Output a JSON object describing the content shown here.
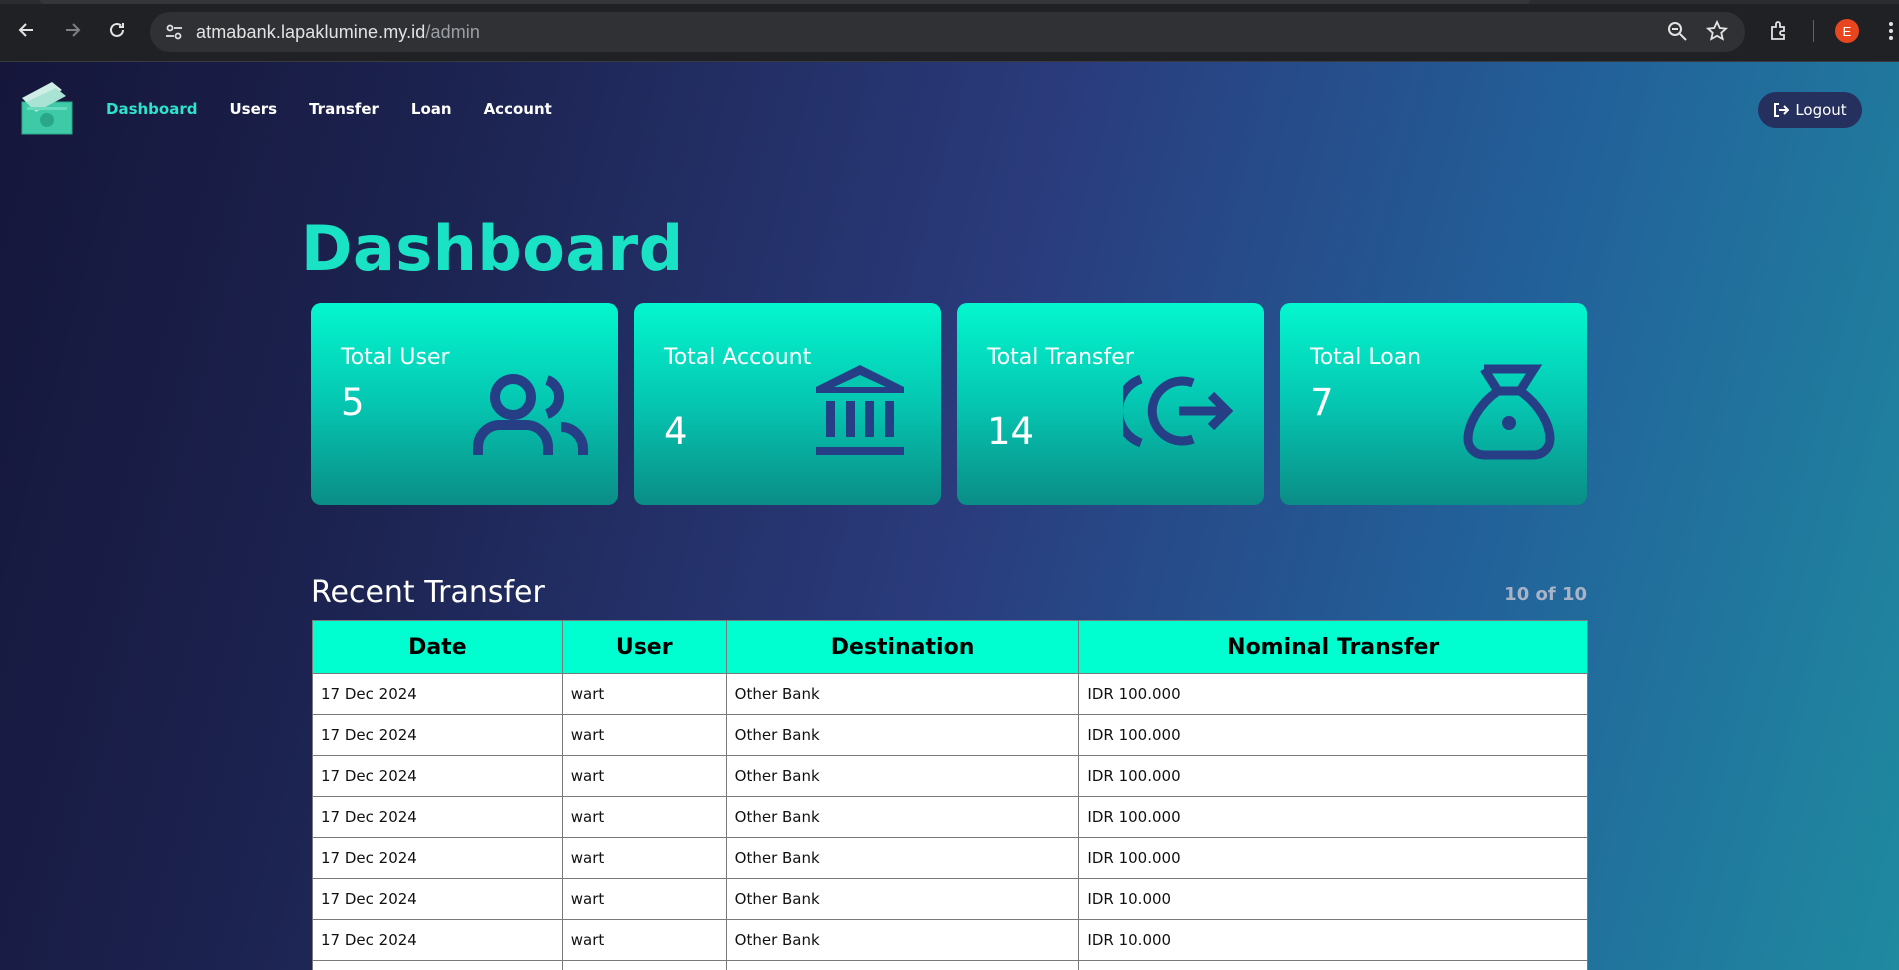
{
  "browser": {
    "url_host": "atmabank.lapaklumine.my.id",
    "url_path": "/admin",
    "profile_initial": "E"
  },
  "nav": {
    "items": [
      {
        "label": "Dashboard",
        "active": true
      },
      {
        "label": "Users",
        "active": false
      },
      {
        "label": "Transfer",
        "active": false
      },
      {
        "label": "Loan",
        "active": false
      },
      {
        "label": "Account",
        "active": false
      }
    ],
    "logout_label": "Logout"
  },
  "page": {
    "title": "Dashboard"
  },
  "cards": [
    {
      "label": "Total User",
      "value": "5",
      "icon": "users-icon"
    },
    {
      "label": "Total Account",
      "value": "4",
      "icon": "bank-icon"
    },
    {
      "label": "Total Transfer",
      "value": "14",
      "icon": "transfer-out-icon"
    },
    {
      "label": "Total Loan",
      "value": "7",
      "icon": "money-bag-icon"
    }
  ],
  "recent_transfer": {
    "title": "Recent Transfer",
    "pager": "10 of 10",
    "columns": [
      "Date",
      "User",
      "Destination",
      "Nominal Transfer"
    ],
    "rows": [
      [
        "17 Dec 2024",
        "wart",
        "Other Bank",
        "IDR 100.000"
      ],
      [
        "17 Dec 2024",
        "wart",
        "Other Bank",
        "IDR 100.000"
      ],
      [
        "17 Dec 2024",
        "wart",
        "Other Bank",
        "IDR 100.000"
      ],
      [
        "17 Dec 2024",
        "wart",
        "Other Bank",
        "IDR 100.000"
      ],
      [
        "17 Dec 2024",
        "wart",
        "Other Bank",
        "IDR 100.000"
      ],
      [
        "17 Dec 2024",
        "wart",
        "Other Bank",
        "IDR 10.000"
      ],
      [
        "17 Dec 2024",
        "wart",
        "Other Bank",
        "IDR 10.000"
      ]
    ]
  },
  "colors": {
    "accent": "#19e3c4",
    "card_top": "#04f7cf",
    "card_bottom": "#0a8d86",
    "icon": "#253e86",
    "table_header": "#00ffd0"
  }
}
